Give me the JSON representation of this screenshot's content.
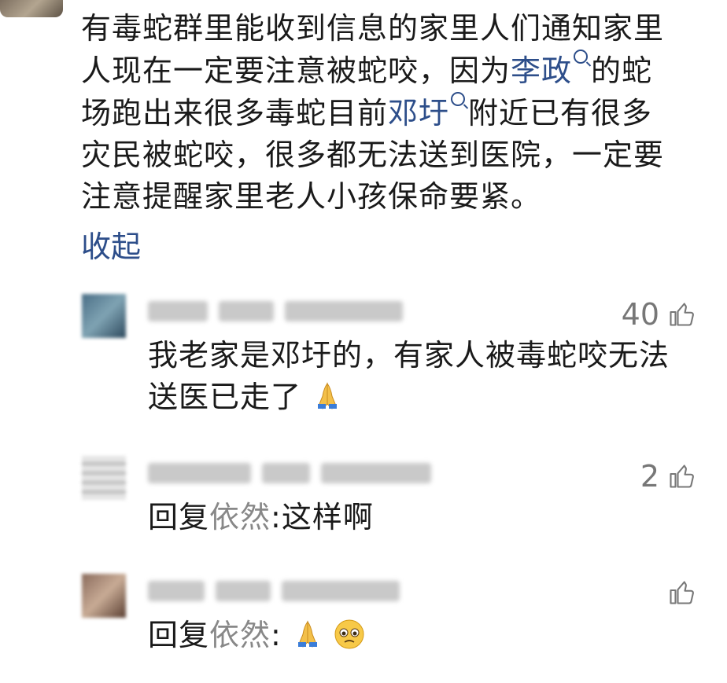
{
  "main_comment": {
    "line1": "有毒蛇群里能收到信息的家里人们通知家里",
    "line2_pre": "人现在一定要注意被蛇咬，因为",
    "line2_link": "李政",
    "line2_post": "的蛇",
    "line3_pre": "场跑出来很多毒蛇目前",
    "line3_link": "邓圩",
    "line3_post": "附近已有很多",
    "line4": "灾民被蛇咬，很多都无法送到医院，一定要",
    "line5": "注意提醒家里老人小孩保命要紧。",
    "collapse_label": "收起"
  },
  "replies": [
    {
      "likes": "40",
      "text_line1": "我老家是邓圩的，有家人被毒蛇咬无法",
      "text_line2": "送医已走了"
    },
    {
      "likes": "2",
      "reply_prefix": "回复",
      "reply_to": "依然",
      "reply_sep": ":",
      "text": "这样啊"
    },
    {
      "likes": "",
      "reply_prefix": "回复",
      "reply_to": "依然",
      "reply_sep": ":"
    }
  ],
  "colors": {
    "link": "#2d4e8a",
    "text": "#1a1a1a",
    "muted": "#777777"
  }
}
